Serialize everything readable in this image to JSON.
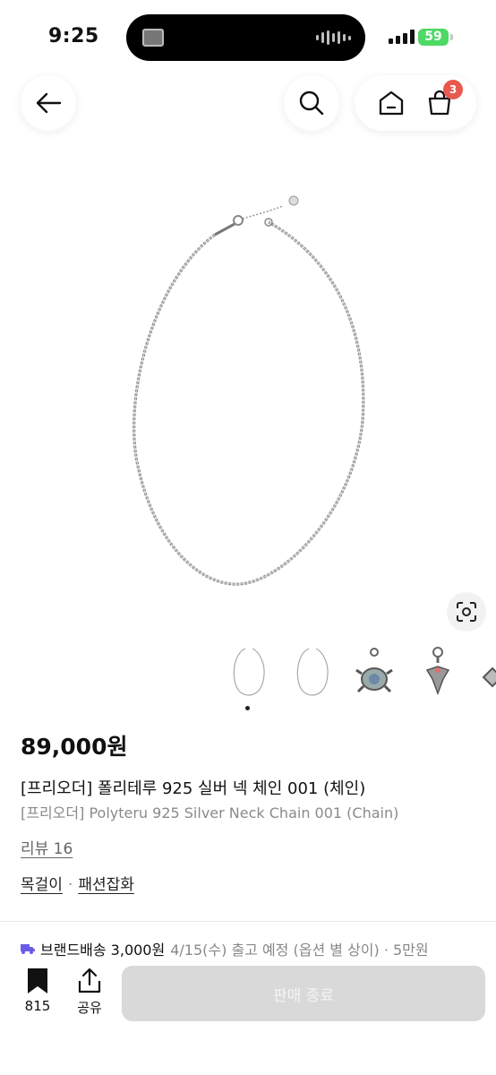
{
  "status_bar": {
    "time": "9:25",
    "battery": "59"
  },
  "header": {
    "back_icon": "arrow-left-icon",
    "search_icon": "search-icon",
    "home_icon": "home-icon",
    "cart_icon": "shopping-bag-icon",
    "cart_count": "3"
  },
  "gallery": {
    "current_index": 1,
    "thumbnails": [
      "chain-thumb",
      "chain-thumb",
      "turtle-charm-thumb",
      "angel-charm-thumb",
      "diamond-charm-thumb"
    ]
  },
  "product": {
    "price": "89,000원",
    "title_ko": "[프리오더] 폴리테루 925 실버 넥 체인 001 (체인)",
    "title_en": "[프리오더] Polyteru 925 Silver Neck Chain 001 (Chain)",
    "review_label": "리뷰 16",
    "categories": [
      "목걸이",
      "패션잡화"
    ],
    "category_separator": "·"
  },
  "shipping": {
    "brand_label": "브랜드배송 3,000원",
    "detail": "4/15(수) 출고 예정 (옵션 별 상이) · 5만원"
  },
  "bottom_bar": {
    "like_count": "815",
    "share_label": "공유",
    "action_label": "판매 종료"
  },
  "colors": {
    "badge": "#e85a4f",
    "battery": "#4cd964",
    "disabled_button": "#d9d9d9",
    "shipping_icon": "#6b5ce7"
  }
}
